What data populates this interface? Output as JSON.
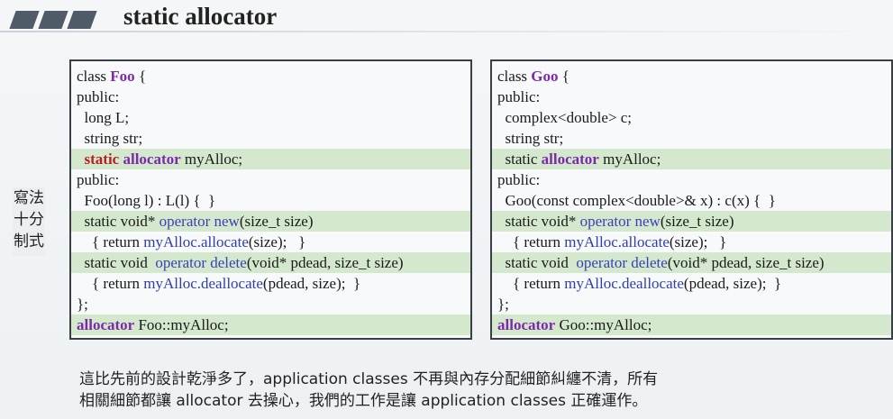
{
  "slide": {
    "title": "static allocator",
    "side_label": [
      "寫法",
      "十分",
      "制式"
    ]
  },
  "foo_code": [
    "class Foo {",
    "public:",
    "  long L;",
    "  string str;",
    "  static allocator myAlloc;",
    "public:",
    "  Foo(long l) : L(l) {  }",
    "  static void* operator new(size_t size)",
    "    { return myAlloc.allocate(size);   }",
    "  static void  operator delete(void* pdead, size_t size)",
    "    { return myAlloc.deallocate(pdead, size);  }",
    "};",
    "allocator Foo::myAlloc;"
  ],
  "goo_code": [
    "class Goo {",
    "public:",
    "  complex<double> c;",
    "  string str;",
    "  static allocator myAlloc;",
    "public:",
    "  Goo(const complex<double>& x) : c(x) {  }",
    "  static void* operator new(size_t size)",
    "    { return myAlloc.allocate(size);   }",
    "  static void  operator delete(void* pdead, size_t size)",
    "    { return myAlloc.deallocate(pdead, size);  }",
    "};",
    "allocator Goo::myAlloc;"
  ],
  "description": [
    "這比先前的設計乾淨多了，application classes 不再與內存分配細節糾纏不清，所有",
    "相關細節都讓 allocator 去操心，我們的工作是讓 application classes 正確運作。"
  ],
  "colors": {
    "keyword_blue": "#3b3fb8",
    "keyword_purple": "#7b2aa8",
    "keyword_red": "#b62020",
    "highlight_green": "#c8e2be"
  }
}
